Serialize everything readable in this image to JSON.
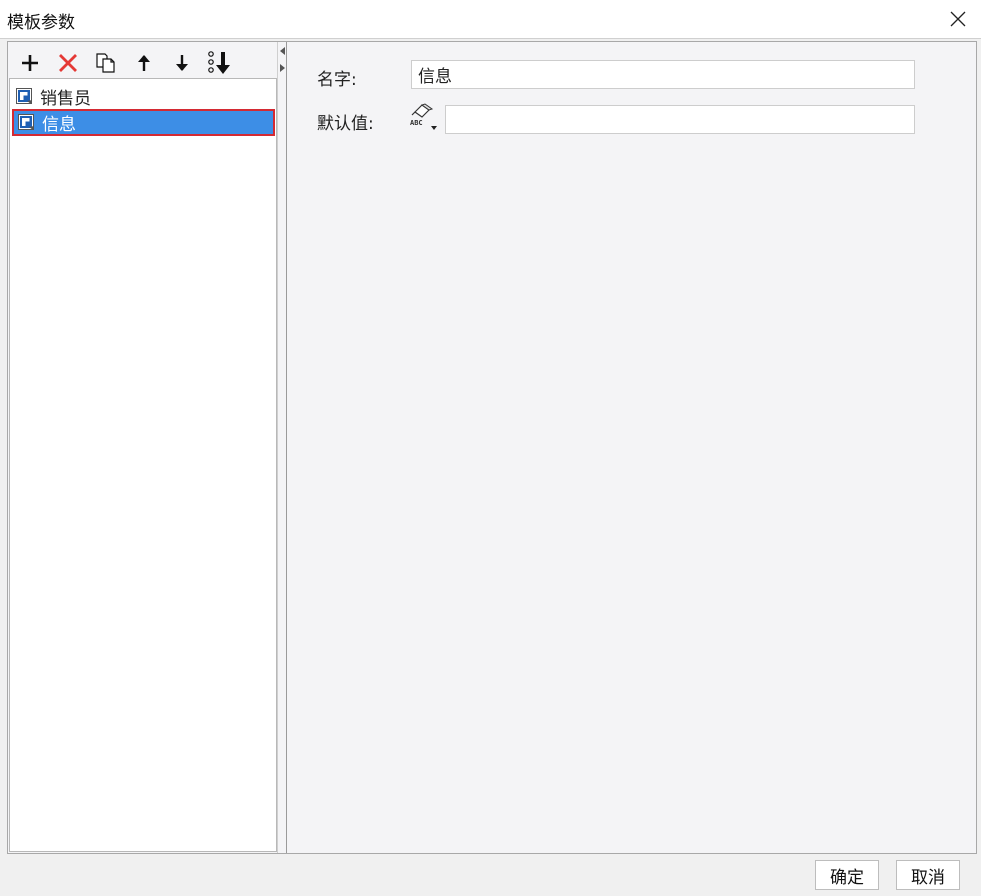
{
  "window": {
    "title": "模板参数",
    "close_icon": "close-icon"
  },
  "toolbar": {
    "buttons": [
      {
        "name": "add",
        "icon": "plus-icon"
      },
      {
        "name": "delete",
        "icon": "delete-x-icon"
      },
      {
        "name": "copy",
        "icon": "copy-icon"
      },
      {
        "name": "move-up",
        "icon": "arrow-up-icon"
      },
      {
        "name": "move-down",
        "icon": "arrow-down-icon"
      },
      {
        "name": "sort",
        "icon": "sort-down-icon"
      }
    ]
  },
  "param_list": {
    "items": [
      {
        "label": "销售员",
        "selected": false
      },
      {
        "label": "信息",
        "selected": true
      }
    ]
  },
  "form": {
    "name_label": "名字:",
    "name_value": "信息",
    "default_label": "默认值:",
    "default_value": "",
    "type_icon": "abc-type-icon"
  },
  "footer": {
    "ok_label": "确定",
    "cancel_label": "取消"
  },
  "colors": {
    "selection_bg": "#3d8ee6",
    "selection_border": "#d42a33",
    "delete_red": "#e53935"
  }
}
